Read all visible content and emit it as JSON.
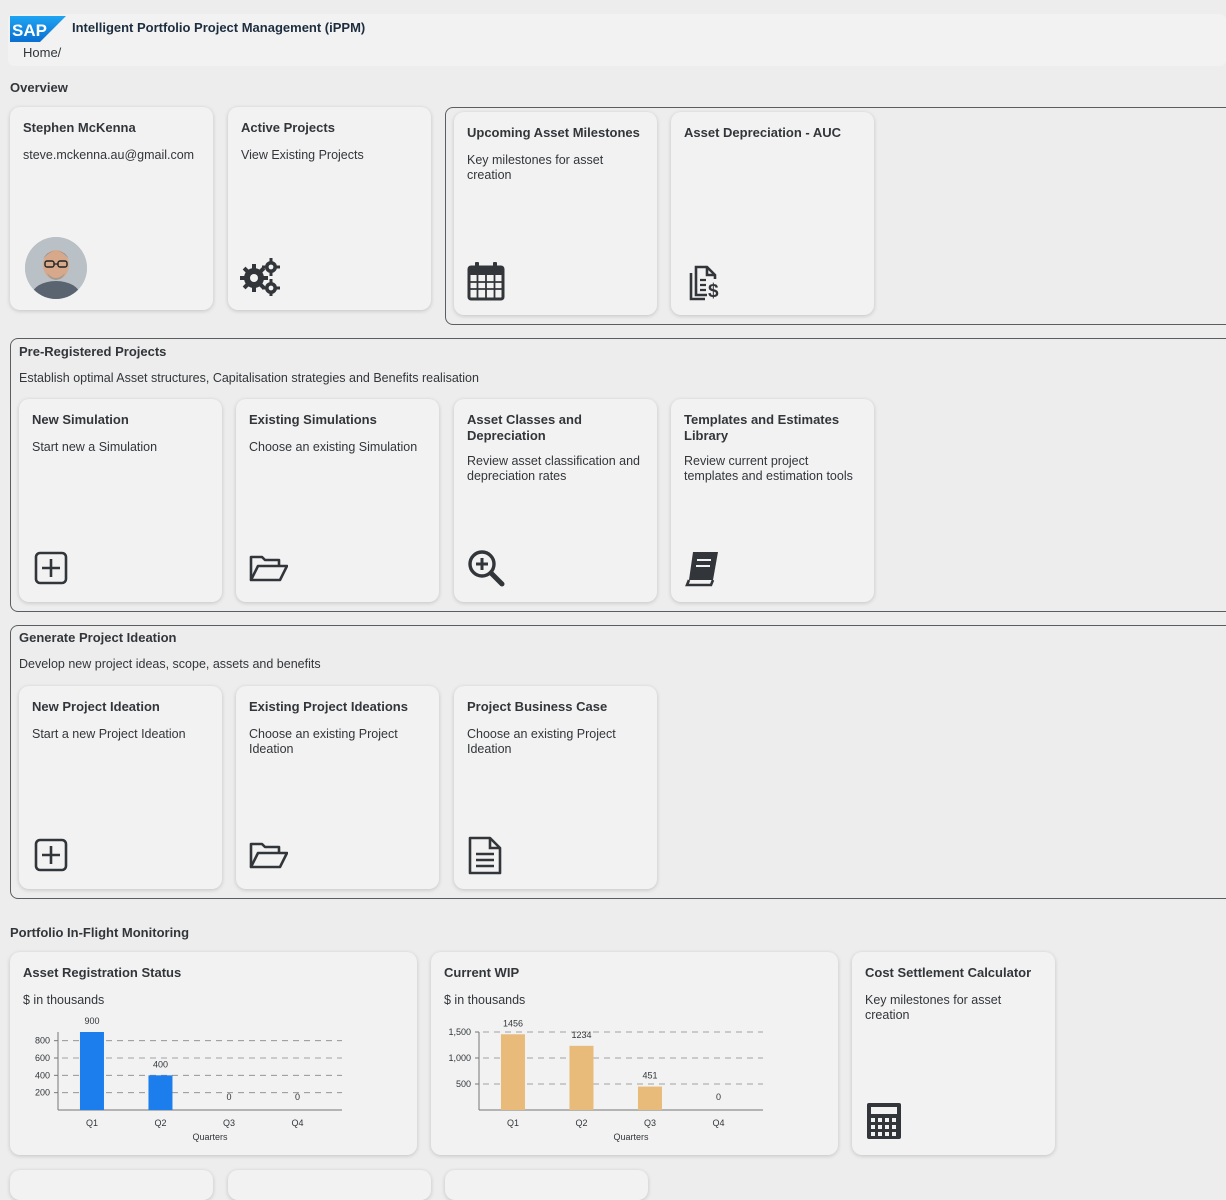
{
  "header": {
    "logo_text": "SAP",
    "app_title": "Intelligent Portfolio Project Management (iPPM)",
    "breadcrumb": "Home/"
  },
  "overview": {
    "title": "Overview",
    "user_tile": {
      "name": "Stephen McKenna",
      "email": "steve.mckenna.au@gmail.com",
      "icon": "avatar"
    },
    "active_projects": {
      "title": "Active Projects",
      "subtitle": "View Existing Projects",
      "icon": "gears-icon"
    },
    "milestones": {
      "title": "Upcoming Asset Milestones",
      "subtitle": "Key milestones for asset creation",
      "icon": "calendar-icon"
    },
    "depreciation": {
      "title": "Asset Depreciation - AUC",
      "subtitle": "",
      "icon": "document-dollar-icon"
    }
  },
  "pre_registered": {
    "title": "Pre-Registered Projects",
    "description": "Establish optimal Asset structures, Capitalisation strategies and Benefits realisation",
    "tiles": [
      {
        "title": "New Simulation",
        "subtitle": "Start new a Simulation",
        "icon": "add-square-icon"
      },
      {
        "title": "Existing Simulations",
        "subtitle": "Choose an existing Simulation",
        "icon": "folder-open-icon"
      },
      {
        "title": "Asset Classes and Depreciation",
        "subtitle": "Review asset classification and depreciation rates",
        "icon": "zoom-in-icon"
      },
      {
        "title": "Templates and Estimates Library",
        "subtitle": "Review current project templates and estimation tools",
        "icon": "book-icon"
      }
    ]
  },
  "ideation": {
    "title": "Generate Project Ideation",
    "description": "Develop new project ideas, scope, assets and benefits",
    "tiles": [
      {
        "title": "New Project Ideation",
        "subtitle": "Start a new Project Ideation",
        "icon": "add-square-icon"
      },
      {
        "title": "Existing Project Ideations",
        "subtitle": "Choose an existing Project Ideation",
        "icon": "folder-open-icon"
      },
      {
        "title": "Project Business Case",
        "subtitle": "Choose an existing Project Ideation",
        "icon": "document-text-icon"
      }
    ]
  },
  "monitoring": {
    "title": "Portfolio In-Flight Monitoring",
    "asset_registration": {
      "title": "Asset Registration Status",
      "subtitle": "$ in thousands"
    },
    "current_wip": {
      "title": "Current WIP",
      "subtitle": "$ in thousands"
    },
    "cost_settlement": {
      "title": "Cost Settlement Calculator",
      "subtitle": "Key milestones for asset creation",
      "icon": "calculator-icon"
    }
  },
  "chart_data": [
    {
      "type": "bar",
      "categories": [
        "Q1",
        "Q2",
        "Q3",
        "Q4"
      ],
      "values": [
        900,
        400,
        0,
        0
      ],
      "value_labels": [
        "900",
        "400",
        "0",
        "0"
      ],
      "yticks": [
        "200",
        "400",
        "600",
        "800"
      ],
      "ylim": [
        0,
        900
      ],
      "xlabel": "Quarters",
      "color": "#1b7eec"
    },
    {
      "type": "bar",
      "categories": [
        "Q1",
        "Q2",
        "Q3",
        "Q4"
      ],
      "values": [
        1456,
        1234,
        451,
        0
      ],
      "value_labels": [
        "1456",
        "1234",
        "451",
        "0"
      ],
      "yticks": [
        "500",
        "1,000",
        "1,500"
      ],
      "ylim": [
        0,
        1500
      ],
      "xlabel": "Quarters",
      "color": "#e8bb7a"
    }
  ],
  "colors": {
    "background": "#ededed",
    "tile": "#f2f2f2",
    "sap_blue": "#1b7eec",
    "wip_bar": "#e8bb7a"
  }
}
